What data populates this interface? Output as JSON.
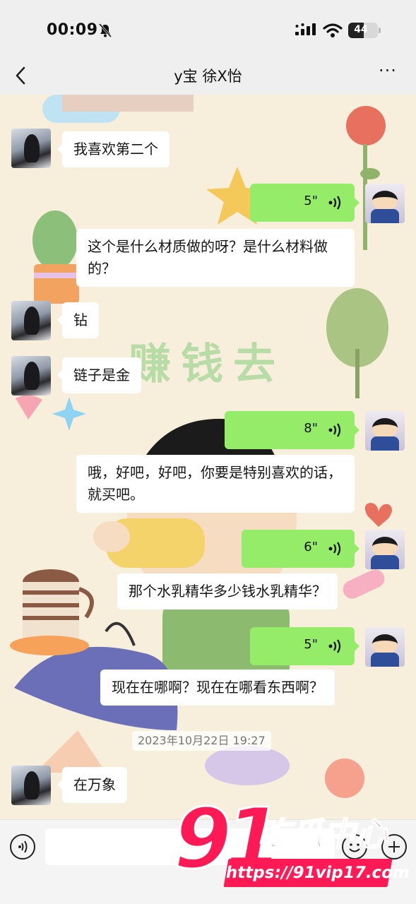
{
  "status_bar": {
    "time": "00:09",
    "battery": "44"
  },
  "nav": {
    "title": "y宝 徐X怡",
    "more": "···"
  },
  "background": {
    "slogan": "赚钱去"
  },
  "messages": [
    {
      "side": "left",
      "type": "text",
      "text": "我喜欢第二个"
    },
    {
      "side": "right",
      "type": "voice",
      "duration": "5\""
    },
    {
      "side": "right",
      "type": "text",
      "text": "这个是什么材质做的呀？是什么材料做的？"
    },
    {
      "side": "left",
      "type": "text",
      "text": "钻"
    },
    {
      "side": "left",
      "type": "text",
      "text": "链子是金"
    },
    {
      "side": "right",
      "type": "voice",
      "duration": "8\""
    },
    {
      "side": "right",
      "type": "text",
      "text": "哦，好吧，好吧，你要是特别喜欢的话，就买吧。"
    },
    {
      "side": "right",
      "type": "voice",
      "duration": "6\""
    },
    {
      "side": "right",
      "type": "text",
      "text": "那个水乳精华多少钱水乳精华？"
    },
    {
      "side": "right",
      "type": "voice",
      "duration": "5\""
    },
    {
      "side": "right",
      "type": "text",
      "text": "现在在哪啊？现在在哪看东西啊？"
    },
    {
      "side": "left",
      "type": "text",
      "text": "在万象"
    }
  ],
  "timestamp": "2023年10月22日 19:27",
  "input": {
    "placeholder": ""
  },
  "watermark": {
    "number": "91",
    "name": "吃瓜中心",
    "url": "https://91vip17.com"
  },
  "colors": {
    "voice_bubble": "#95ec69",
    "bubble": "#ffffff",
    "watermark": "#ff1a55",
    "background": "#f7eedc"
  },
  "icons": [
    "bell-muted-icon",
    "signal-icon",
    "wifi-icon",
    "battery-icon",
    "back-chevron-icon",
    "more-icon",
    "voice-wave-icon",
    "voice-input-icon",
    "emoji-icon",
    "plus-icon"
  ]
}
